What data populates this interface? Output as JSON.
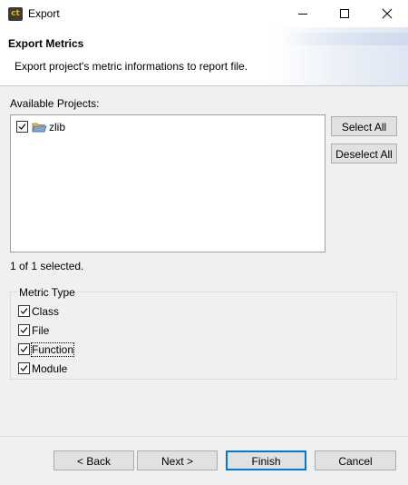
{
  "window": {
    "title": "Export"
  },
  "header": {
    "title": "Export Metrics",
    "description": "Export project's metric informations to report file."
  },
  "projects": {
    "label": "Available Projects:",
    "items": [
      {
        "name": "zlib",
        "checked": true
      }
    ],
    "selection_status": "1 of 1 selected.",
    "select_all_label": "Select All",
    "deselect_all_label": "Deselect All"
  },
  "metric_type": {
    "legend": "Metric Type",
    "options": [
      {
        "label": "Class",
        "checked": true
      },
      {
        "label": "File",
        "checked": true
      },
      {
        "label": "Function",
        "checked": true
      },
      {
        "label": "Module",
        "checked": true
      }
    ]
  },
  "footer": {
    "back_label": "< Back",
    "next_label": "Next >",
    "finish_label": "Finish",
    "cancel_label": "Cancel"
  }
}
